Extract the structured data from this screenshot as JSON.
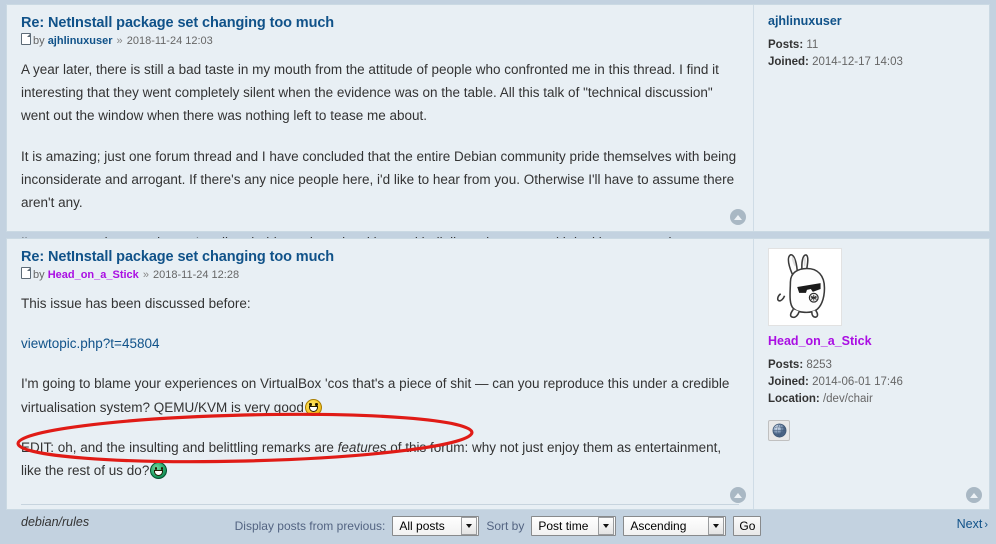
{
  "theme": {
    "page_bg": "#c3d2e0",
    "post_bg": "#e8eff4",
    "link_color": "#105289",
    "author_purple": "#aa0ee3",
    "annotation_color": "#e01b16"
  },
  "posts": [
    {
      "title": "Re: NetInstall package set changing too much",
      "by_label": "by",
      "author": "ajhlinuxuser",
      "separator": "»",
      "timestamp": "2018-11-24 12:03",
      "paragraphs": [
        "A year later, there is still a bad taste in my mouth from the attitude of people who confronted me in this thread. I find it interesting that they went completely silent when the evidence was on the table. All this talk of \"technical discussion\" went out the window when there was nothing left to tease me about.",
        "It is amazing; just one forum thread and I have concluded that the entire Debian community pride themselves with being inconsiderate and arrogant. If there's any nice people here, i'd like to hear from you. Otherwise I'll have to assume there aren't any.",
        "I'm not expecting a reply; you're all probably too busy insulting and belittling other users with legitimate questions."
      ],
      "profile": {
        "name": "ajhlinuxuser",
        "posts_label": "Posts:",
        "posts_value": "11",
        "joined_label": "Joined:",
        "joined_value": "2014-12-17 14:03"
      }
    },
    {
      "title": "Re: NetInstall package set changing too much",
      "by_label": "by",
      "author": "Head_on_a_Stick",
      "separator": "»",
      "timestamp": "2018-11-24 12:28",
      "para_intro": "This issue has been discussed before:",
      "link_text": "viewtopic.php?t=45804",
      "para_vbox_a": "I'm going to blame your experiences on VirtualBox 'cos that's a piece of shit — can you reproduce this under a credible virtualisation system? QEMU/KVM is very good",
      "para_edit_a": "EDIT: oh, and the insulting and belittling remarks are ",
      "para_edit_em": "features",
      "para_edit_b": " of this forum: why not just enjoy them as entertainment, like the rest of us do?",
      "signature": "debian/rules",
      "profile": {
        "name": "Head_on_a_Stick",
        "posts_label": "Posts:",
        "posts_value": "8253",
        "joined_label": "Joined:",
        "joined_value": "2014-06-01 17:46",
        "location_label": "Location:",
        "location_value": "/dev/chair",
        "website_icon": "globe-icon"
      },
      "avatar_alt": "bunny-with-sunglasses-avatar"
    }
  ],
  "footer": {
    "display_label": "Display posts from previous:",
    "display_value": "All posts",
    "sort_label": "Sort by",
    "sort_value": "Post time",
    "order_value": "Ascending",
    "go_label": "Go",
    "next_label": "Next",
    "next_chevron": "›"
  },
  "icons": {
    "back_to_top": "back-to-top-icon",
    "post_doc": "post-document-icon",
    "dropdown": "chevron-down-icon"
  }
}
